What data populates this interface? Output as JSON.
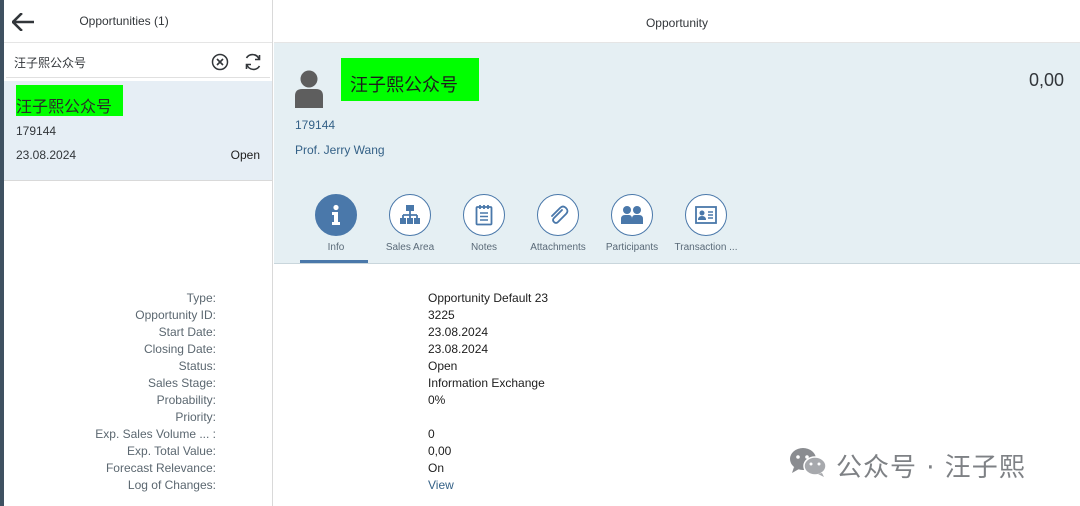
{
  "master": {
    "title": "Opportunities (1)",
    "search": {
      "value": "汪子熙公众号",
      "placeholder": ""
    },
    "items": [
      {
        "title": "汪子熙公众号",
        "id": "179144",
        "date": "23.08.2024",
        "status": "Open"
      }
    ]
  },
  "detail": {
    "title": "Opportunity",
    "header": {
      "title": "汪子熙公众号",
      "number": "0,00",
      "attr1": "179144",
      "attr2": "Prof. Jerry Wang"
    },
    "tabs": [
      {
        "label": "Info",
        "icon": "info-icon",
        "active": true
      },
      {
        "label": "Sales Area",
        "icon": "org-chart-icon",
        "active": false
      },
      {
        "label": "Notes",
        "icon": "notes-icon",
        "active": false
      },
      {
        "label": "Attachments",
        "icon": "paperclip-icon",
        "active": false
      },
      {
        "label": "Participants",
        "icon": "group-icon",
        "active": false
      },
      {
        "label": "Transaction ...",
        "icon": "id-card-icon",
        "active": false
      }
    ],
    "fields": [
      {
        "label": "Type:",
        "value": "Opportunity Default 23"
      },
      {
        "label": "Opportunity ID:",
        "value": "3225"
      },
      {
        "label": "Start Date:",
        "value": "23.08.2024"
      },
      {
        "label": "Closing Date:",
        "value": "23.08.2024"
      },
      {
        "label": "Status:",
        "value": "Open"
      },
      {
        "label": "Sales Stage:",
        "value": "Information Exchange"
      },
      {
        "label": "Probability:",
        "value": "0%"
      },
      {
        "label": "Priority:",
        "value": ""
      },
      {
        "label": "Exp. Sales Volume ... :",
        "value": "0"
      },
      {
        "label": "Exp. Total Value:",
        "value": "0,00"
      },
      {
        "label": "Forecast Relevance:",
        "value": "On"
      },
      {
        "label": "Log of Changes:",
        "value": "View"
      }
    ]
  },
  "watermark": {
    "text": "公众号 · 汪子熙"
  },
  "colors": {
    "accent": "#4a78aa",
    "highlight": "#00ff00",
    "header_bg": "#e5eff3",
    "selected_bg": "#e6eef5"
  }
}
